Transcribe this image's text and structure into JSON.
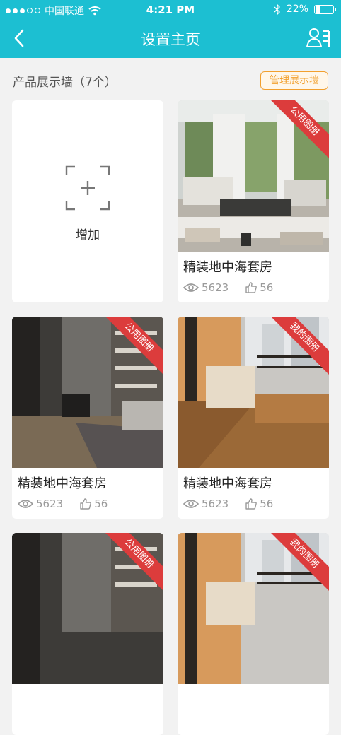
{
  "status_bar": {
    "carrier": "中国联通",
    "time": "4:21 PM",
    "battery_percent_text": "22%",
    "battery_level": 0.22
  },
  "nav": {
    "title": "设置主页",
    "back_icon": "chevron-left-icon",
    "user_icon": "user-list-icon"
  },
  "section": {
    "title": "产品展示墙（7个）",
    "manage_label": "管理展示墙"
  },
  "add_card": {
    "label": "增加"
  },
  "cards": [
    {
      "name": "精装地中海套房",
      "views": "5623",
      "likes": "56",
      "tag": "公用图册"
    },
    {
      "name": "精装地中海套房",
      "views": "5623",
      "likes": "56",
      "tag": "公用图册"
    },
    {
      "name": "精装地中海套房",
      "views": "5623",
      "likes": "56",
      "tag": "我的图册"
    },
    {
      "name": "",
      "views": "",
      "likes": "",
      "tag": "公用图册"
    },
    {
      "name": "",
      "views": "",
      "likes": "",
      "tag": "我的图册"
    }
  ],
  "colors": {
    "primary": "#1cbfd2",
    "accent": "#f2a02e",
    "ribbon": "#dc3c3c"
  }
}
